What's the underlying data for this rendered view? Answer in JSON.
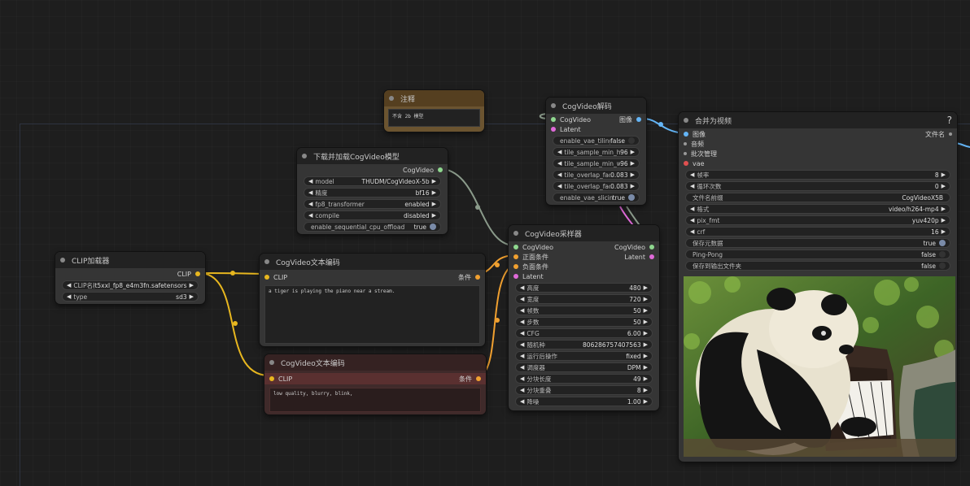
{
  "note_node": {
    "title": "注释",
    "text": "不含 2b 模型"
  },
  "loader_node": {
    "title": "下载并加载CogVideo模型",
    "output": "CogVideo",
    "widgets": [
      {
        "label": "model",
        "value": "THUDM/CogVideoX-5b"
      },
      {
        "label": "精度",
        "value": "bf16"
      },
      {
        "label": "fp8_transformer",
        "value": "enabled"
      },
      {
        "label": "compile",
        "value": "disabled"
      }
    ],
    "toggle": {
      "label": "enable_sequential_cpu_offload",
      "value": "true"
    }
  },
  "clip_node": {
    "title": "CLIP加载器",
    "output": "CLIP",
    "widgets": [
      {
        "label": "CLIP名称",
        "value": "t5xxl_fp8_e4m3fn.safetensors"
      },
      {
        "label": "type",
        "value": "sd3"
      }
    ]
  },
  "text_pos_node": {
    "title": "CogVideo文本编码",
    "input": "CLIP",
    "output": "条件",
    "text": "a tiger is playing the piano near a stream."
  },
  "text_neg_node": {
    "title": "CogVideo文本编码",
    "input": "CLIP",
    "output": "条件",
    "text": "low quality, blurry, blink,"
  },
  "decode_node": {
    "title": "CogVideo解码",
    "inputs": [
      "CogVideo",
      "Latent"
    ],
    "output": "图像",
    "toggle1": {
      "label": "enable_vae_tiling",
      "value": "false"
    },
    "widgets": [
      {
        "label": "tile_sample_min_height",
        "value": "96"
      },
      {
        "label": "tile_sample_min_width",
        "value": "96"
      },
      {
        "label": "tile_overlap_factor_height",
        "value": "0.083"
      },
      {
        "label": "tile_overlap_factor_width",
        "value": "0.083"
      }
    ],
    "toggle2": {
      "label": "enable_vae_slicing",
      "value": "true"
    }
  },
  "sampler_node": {
    "title": "CogVideo采样器",
    "inputs": [
      "CogVideo",
      "正面条件",
      "负面条件",
      "Latent"
    ],
    "outputs": [
      "CogVideo",
      "Latent"
    ],
    "widgets": [
      {
        "label": "高度",
        "value": "480"
      },
      {
        "label": "宽度",
        "value": "720"
      },
      {
        "label": "帧数",
        "value": "50"
      },
      {
        "label": "步数",
        "value": "50"
      },
      {
        "label": "CFG",
        "value": "6.00"
      },
      {
        "label": "随机种",
        "value": "806286757407563"
      },
      {
        "label": "运行后操作",
        "value": "fixed"
      },
      {
        "label": "调度器",
        "value": "DPM"
      },
      {
        "label": "分块长度",
        "value": "49"
      },
      {
        "label": "分块重叠",
        "value": "8"
      },
      {
        "label": "降噪",
        "value": "1.00"
      }
    ]
  },
  "combine_node": {
    "title": "合并为视频",
    "help": "?",
    "inputs": [
      "图像",
      "音频",
      "批次管理",
      "vae"
    ],
    "output": "文件名",
    "widgets": [
      {
        "label": "帧率",
        "value": "8"
      },
      {
        "label": "循环次数",
        "value": "0"
      }
    ],
    "prefix": {
      "label": "文件名前缀",
      "value": "CogVideoX5B"
    },
    "widgets2": [
      {
        "label": "格式",
        "value": "video/h264-mp4"
      },
      {
        "label": "pix_fmt",
        "value": "yuv420p"
      },
      {
        "label": "crf",
        "value": "16"
      }
    ],
    "toggles": [
      {
        "label": "保存元数据",
        "value": "true"
      },
      {
        "label": "Ping-Pong",
        "value": "false"
      },
      {
        "label": "保存到输出文件夹",
        "value": "false"
      }
    ]
  },
  "colors": {
    "clip_link": "#e8b71f",
    "cogvideo_link": "#9ab",
    "conditioning_link": "#f0a030",
    "latent_link": "#e06ad9",
    "image_link": "#64b5f6"
  }
}
